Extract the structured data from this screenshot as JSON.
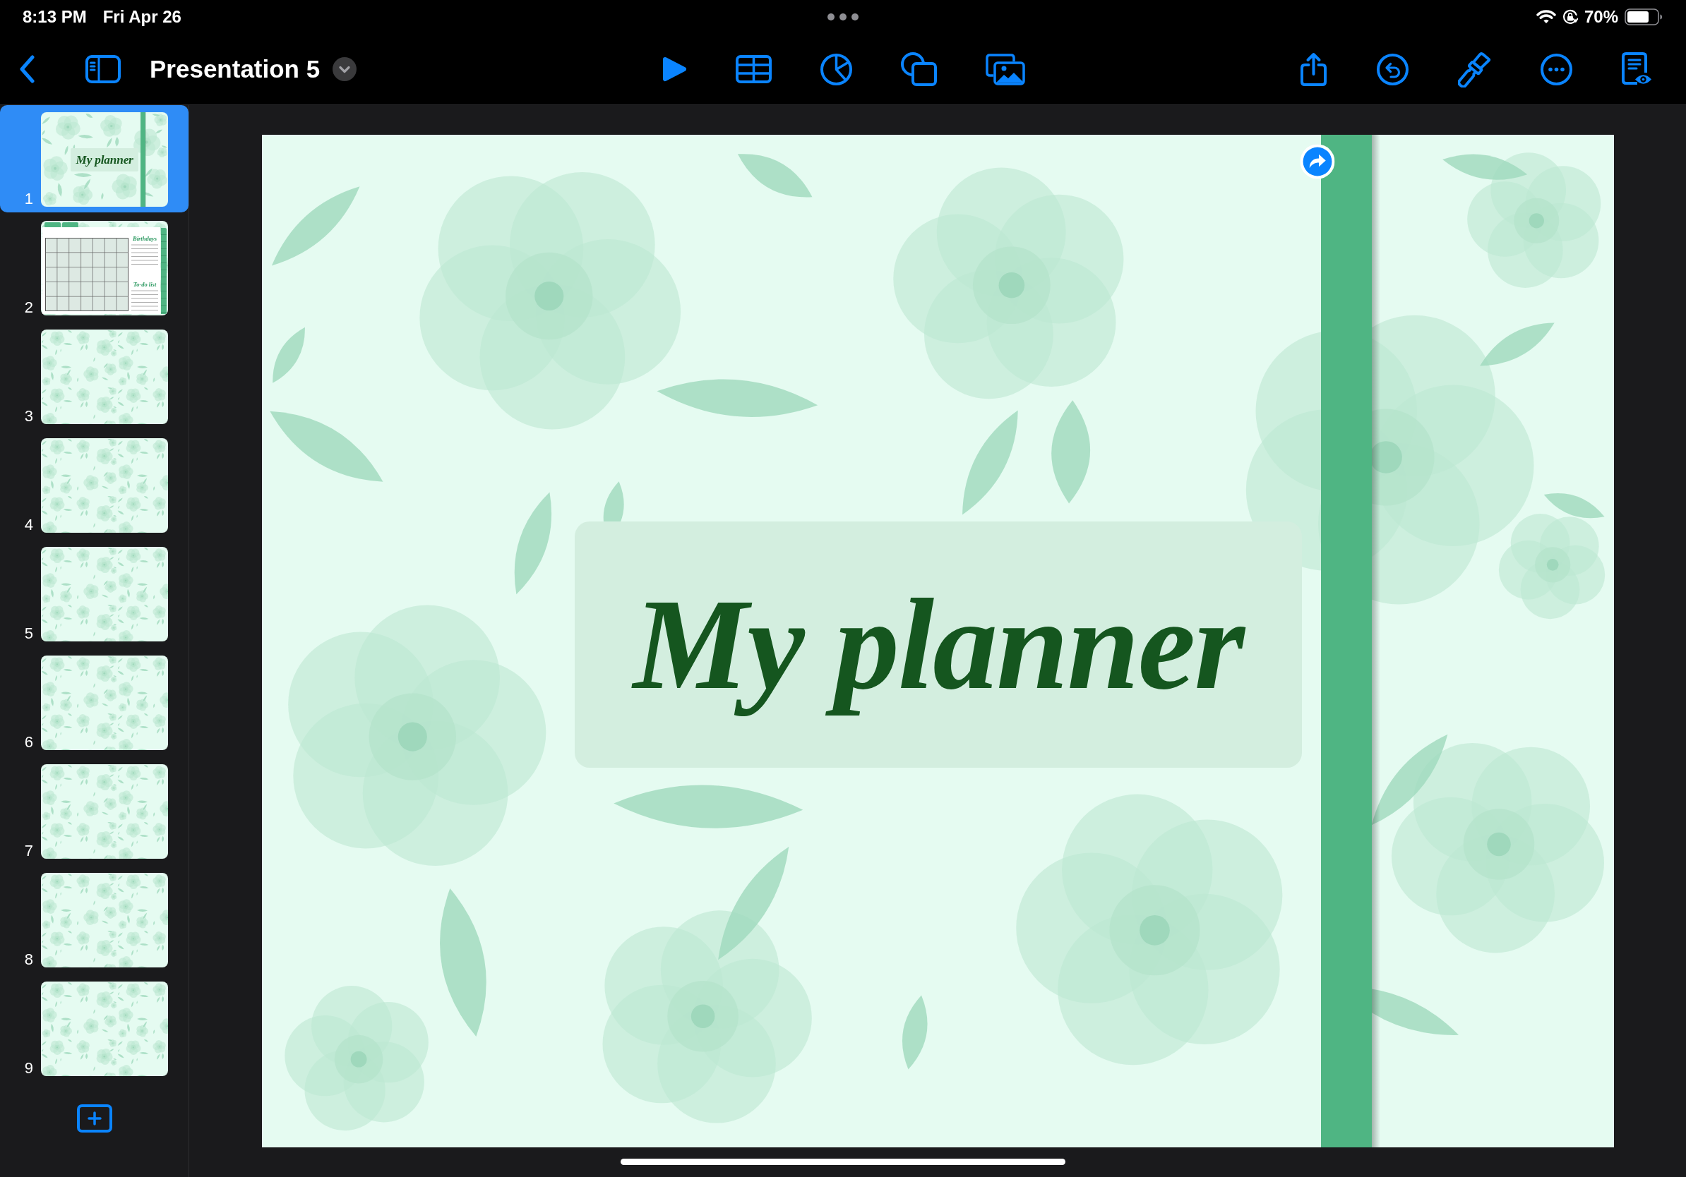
{
  "status_bar": {
    "time": "8:13 PM",
    "date": "Fri Apr 26",
    "battery": "70%"
  },
  "toolbar": {
    "title": "Presentation 5"
  },
  "sidebar": {
    "slides": [
      {
        "number": "1",
        "kind": "cover",
        "selected": true,
        "title": "My planner"
      },
      {
        "number": "2",
        "kind": "calendar",
        "selected": false,
        "headings": [
          "Birthdays",
          "To-do list"
        ]
      },
      {
        "number": "3",
        "kind": "pattern",
        "selected": false
      },
      {
        "number": "4",
        "kind": "pattern",
        "selected": false
      },
      {
        "number": "5",
        "kind": "pattern",
        "selected": false
      },
      {
        "number": "6",
        "kind": "pattern",
        "selected": false
      },
      {
        "number": "7",
        "kind": "pattern",
        "selected": false
      },
      {
        "number": "8",
        "kind": "pattern",
        "selected": false
      },
      {
        "number": "9",
        "kind": "pattern",
        "selected": false
      }
    ]
  },
  "slide": {
    "title": "My planner"
  }
}
